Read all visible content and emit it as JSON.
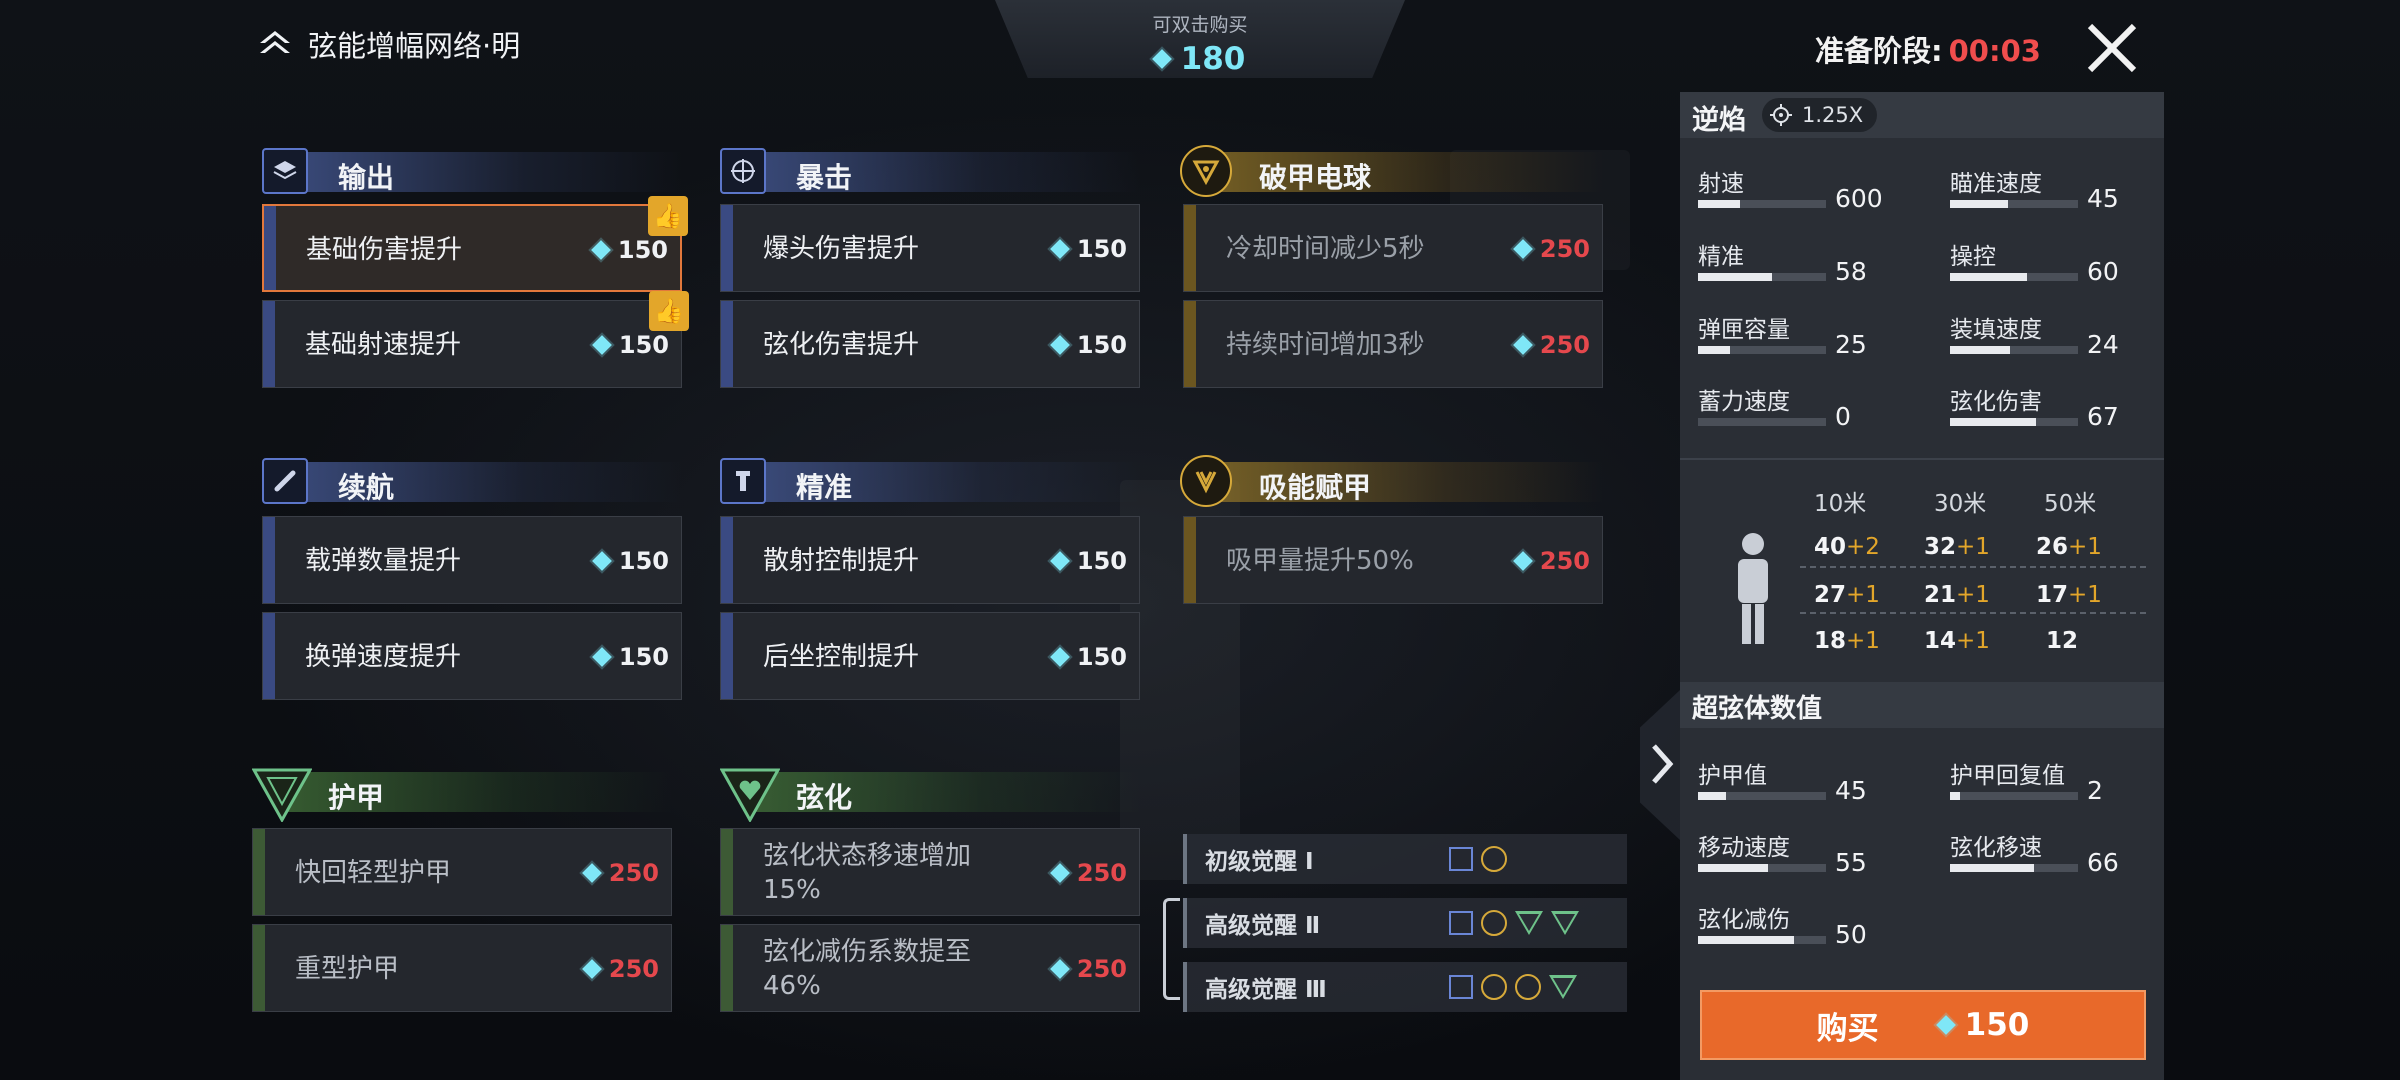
{
  "title": "弦能增幅网络·明",
  "currency": {
    "hint": "可双击购买",
    "amount": "180"
  },
  "prep": {
    "label": "准备阶段:",
    "time": "00:03"
  },
  "categories": {
    "output": {
      "label": "输出",
      "items": [
        {
          "name": "基础伤害提升",
          "price": "150"
        },
        {
          "name": "基础射速提升",
          "price": "150"
        }
      ]
    },
    "crit": {
      "label": "暴击",
      "items": [
        {
          "name": "爆头伤害提升",
          "price": "150"
        },
        {
          "name": "弦化伤害提升",
          "price": "150"
        }
      ]
    },
    "orb": {
      "label": "破甲电球",
      "items": [
        {
          "name": "冷却时间减少5秒",
          "price": "250"
        },
        {
          "name": "持续时间增加3秒",
          "price": "250"
        }
      ]
    },
    "sustain": {
      "label": "续航",
      "items": [
        {
          "name": "载弹数量提升",
          "price": "150"
        },
        {
          "name": "换弹速度提升",
          "price": "150"
        }
      ]
    },
    "accuracy": {
      "label": "精准",
      "items": [
        {
          "name": "散射控制提升",
          "price": "150"
        },
        {
          "name": "后坐控制提升",
          "price": "150"
        }
      ]
    },
    "absorb": {
      "label": "吸能赋甲",
      "items": [
        {
          "name": "吸甲量提升50%",
          "price": "250"
        }
      ]
    },
    "armor": {
      "label": "护甲",
      "items": [
        {
          "name": "快回轻型护甲",
          "price": "250"
        },
        {
          "name": "重型护甲",
          "price": "250"
        }
      ]
    },
    "string": {
      "label": "弦化",
      "items": [
        {
          "name_line1": "弦化状态移速增加",
          "name_line2": "15%",
          "price": "250"
        },
        {
          "name_line1": "弦化减伤系数提至",
          "name_line2": "46%",
          "price": "250"
        }
      ]
    }
  },
  "awakenings": [
    {
      "name": "初级觉醒 Ⅰ"
    },
    {
      "name": "高级觉醒 Ⅱ"
    },
    {
      "name": "高级觉醒 Ⅲ"
    }
  ],
  "panel": {
    "weapon": "逆焰",
    "zoom": "1.25X",
    "stats": [
      {
        "label": "射速",
        "value": "600",
        "fill": 0.33
      },
      {
        "label": "瞄准速度",
        "value": "45",
        "fill": 0.45
      },
      {
        "label": "精准",
        "value": "58",
        "fill": 0.58
      },
      {
        "label": "操控",
        "value": "60",
        "fill": 0.6
      },
      {
        "label": "弹匣容量",
        "value": "25",
        "fill": 0.25
      },
      {
        "label": "装填速度",
        "value": "24",
        "fill": 0.47
      },
      {
        "label": "蓄力速度",
        "value": "0",
        "fill": 0.0
      },
      {
        "label": "弦化伤害",
        "value": "67",
        "fill": 0.67
      }
    ],
    "ranges": [
      "10米",
      "30米",
      "50米"
    ],
    "damage": [
      [
        {
          "v": "40",
          "p": "+2"
        },
        {
          "v": "32",
          "p": "+1"
        },
        {
          "v": "26",
          "p": "+1"
        }
      ],
      [
        {
          "v": "27",
          "p": "+1"
        },
        {
          "v": "21",
          "p": "+1"
        },
        {
          "v": "17",
          "p": "+1"
        }
      ],
      [
        {
          "v": "18",
          "p": "+1"
        },
        {
          "v": "14",
          "p": "+1"
        },
        {
          "v": "12",
          "p": ""
        }
      ]
    ],
    "super_title": "超弦体数值",
    "super_stats": [
      {
        "label": "护甲值",
        "value": "45",
        "fill": 0.22
      },
      {
        "label": "护甲回复值",
        "value": "2",
        "fill": 0.08
      },
      {
        "label": "移动速度",
        "value": "55",
        "fill": 0.55
      },
      {
        "label": "弦化移速",
        "value": "66",
        "fill": 0.66
      },
      {
        "label": "弦化减伤",
        "value": "50",
        "fill": 0.75
      }
    ],
    "buy_label": "购买",
    "buy_price": "150"
  },
  "colors": {
    "accent_orange": "#e8692a",
    "gem": "#7fe7f7",
    "price_red": "#e5484d",
    "gold": "#d6a93a"
  }
}
